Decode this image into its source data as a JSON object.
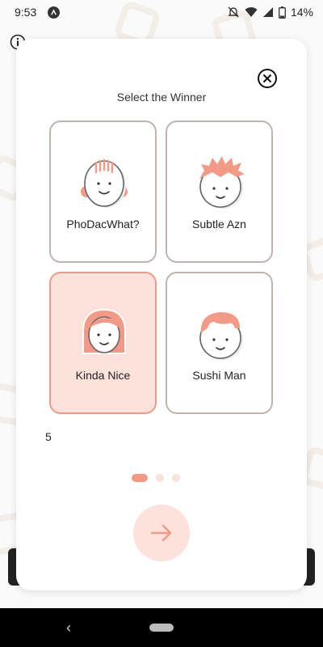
{
  "status_bar": {
    "time": "9:53",
    "battery": "14%",
    "icons": [
      "app-icon",
      "dnd-off-icon",
      "wifi-icon",
      "signal-icon",
      "battery-icon"
    ]
  },
  "dialog": {
    "title": "Select the Winner",
    "options": [
      {
        "label": "PhoDacWhat?",
        "selected": false,
        "icon": "avatar-headband-icon"
      },
      {
        "label": "Subtle Azn",
        "selected": false,
        "icon": "avatar-spiky-hair-icon"
      },
      {
        "label": "Kinda Nice",
        "selected": true,
        "icon": "avatar-long-hair-icon"
      },
      {
        "label": "Sushi Man",
        "selected": false,
        "icon": "avatar-short-hair-icon"
      }
    ],
    "count": "5",
    "pager": {
      "pages": 3,
      "active": 1
    },
    "next_icon": "arrow-right-icon",
    "close_icon": "close-icon"
  },
  "colors": {
    "accent": "#f29a86",
    "accent_light": "#fde1db",
    "card_border": "#c2b2b2",
    "selected_border": "#ee9a86"
  }
}
